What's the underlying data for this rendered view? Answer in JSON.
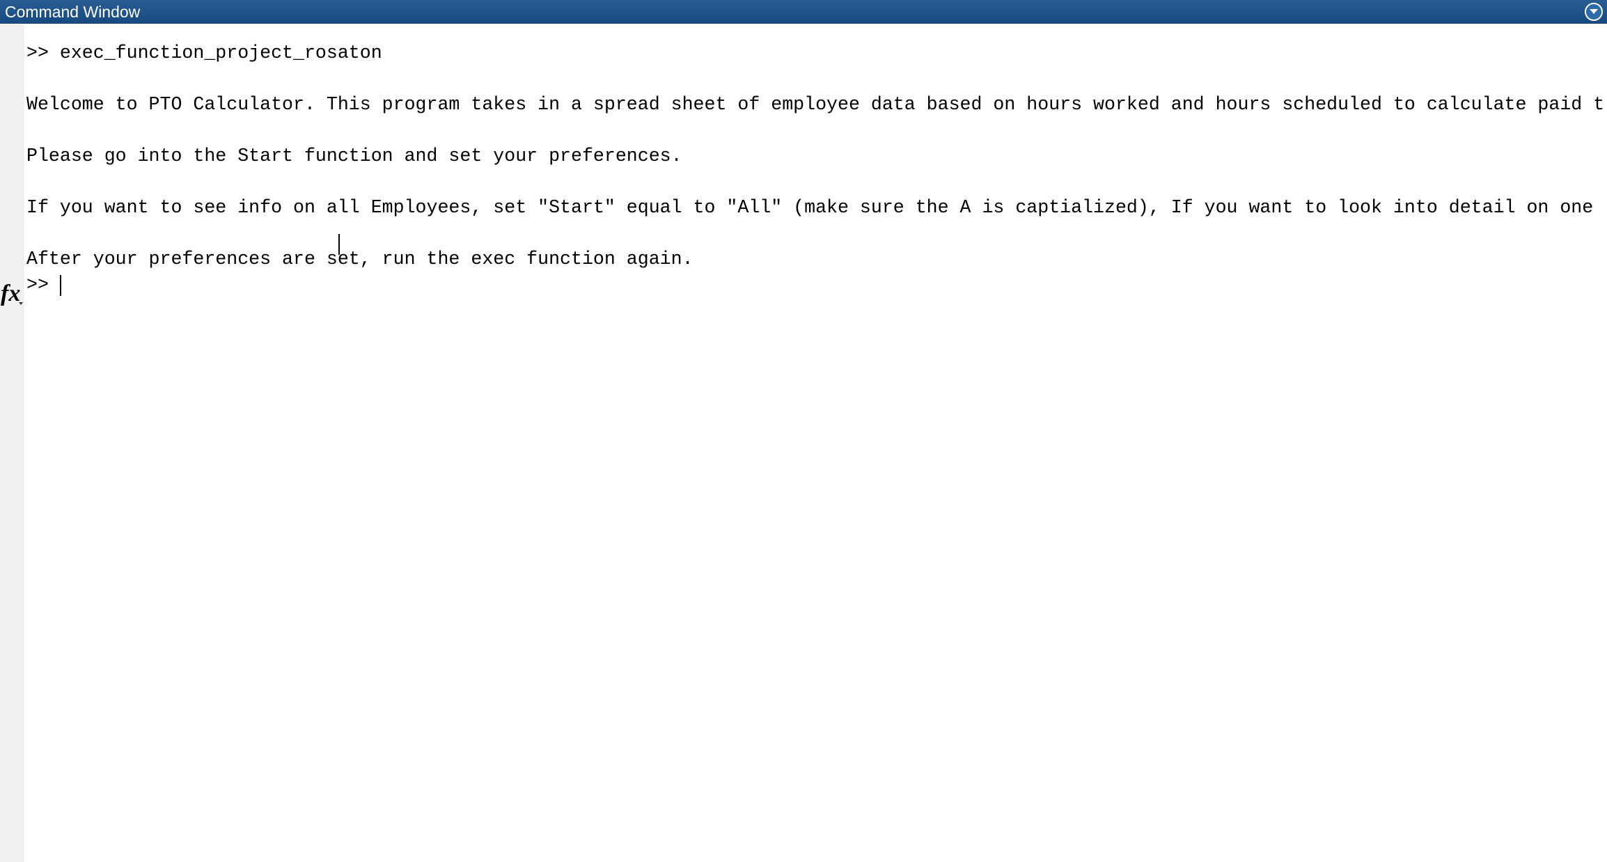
{
  "window": {
    "title": "Command Window"
  },
  "gutter": {
    "function_icon": "fx-icon",
    "function_icon_text": "fx"
  },
  "console": {
    "lines": [
      ">> exec_function_project_rosaton",
      "Welcome to PTO Calculator. This program takes in a spread sheet of employee data based on hours worked and hours scheduled to calculate paid t",
      "Please go into the Start function and set your preferences.",
      "If you want to see info on all Employees, set \"Start\" equal to \"All\" (make sure the A is captialized), If you want to look into detail on one",
      "After your preferences are set, run the exec function again."
    ],
    "prompt": ">>"
  },
  "colors": {
    "titlebar": "#1f5289",
    "gutter": "#f0f0f0",
    "text": "#000000",
    "background": "#ffffff"
  }
}
